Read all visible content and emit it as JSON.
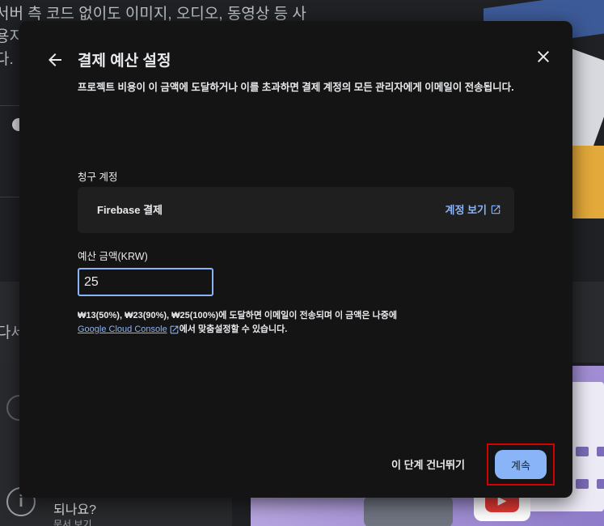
{
  "background": {
    "headline_line1": "서버 측 코드 없이도 이미지, 오디오, 동영상 등 사",
    "headline_line2": "용지",
    "headline_line3": "다.",
    "detail_label": "다세",
    "question_text": "되나요?",
    "doc_link": "문서 보기"
  },
  "dialog": {
    "title": "결제 예산 설정",
    "description": "프로젝트 비용이 이 금액에 도달하거나 이를 초과하면 결제 계정의 모든 관리자에게 이메일이 전송됩니다.",
    "billing_account_label": "청구 계정",
    "billing_account_name": "Firebase 결제",
    "view_account_link": "계정 보기",
    "budget_label": "예산 금액(KRW)",
    "budget_value": "25",
    "hint_text": "₩13(50%), ₩23(90%), ₩25(100%)에 도달하면 이메일이 전송되며 이 금액은 나중에",
    "hint_link": "Google Cloud Console",
    "hint_suffix": "에서 맞춤설정할 수 있습니다.",
    "skip_button": "이 단계 건너뛰기",
    "continue_button": "계속"
  },
  "icons": {
    "back": "arrow-back-icon",
    "close": "close-icon",
    "external": "open-in-new-icon",
    "info": "info-icon"
  },
  "colors": {
    "dialog_bg": "#141414",
    "accent": "#8ab4f8",
    "highlight_box": "#d50000"
  }
}
